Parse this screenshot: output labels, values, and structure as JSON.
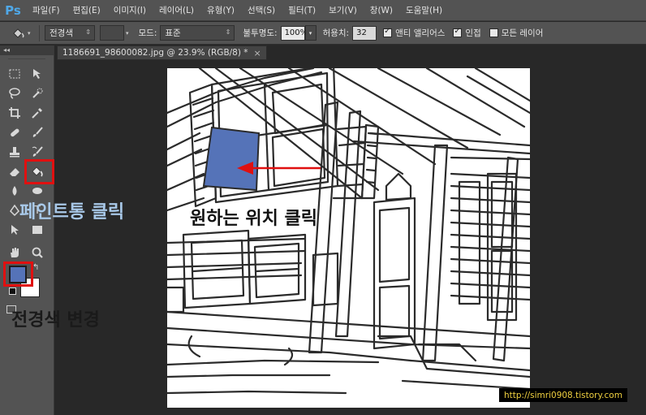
{
  "app": {
    "logo": "Ps"
  },
  "menu": [
    "파일(F)",
    "편집(E)",
    "이미지(I)",
    "레이어(L)",
    "유형(Y)",
    "선택(S)",
    "필터(T)",
    "보기(V)",
    "창(W)",
    "도움말(H)"
  ],
  "options": {
    "fill_source": "전경색",
    "mode_label": "모드:",
    "mode_value": "표준",
    "opacity_label": "불투명도:",
    "opacity_value": "100%",
    "tolerance_label": "허용치:",
    "tolerance_value": "32",
    "antialias_label": "앤티 앨리어스",
    "antialias_checked": true,
    "contiguous_label": "인접",
    "contiguous_checked": true,
    "all_layers_label": "모든 레이어",
    "all_layers_checked": false
  },
  "document": {
    "tab_title": "1186691_98600082.jpg @ 23.9% (RGB/8) *"
  },
  "colors": {
    "foreground": "#5573b8",
    "background": "#ffffff",
    "highlight": "#e01010",
    "annotation_blue": "#a8c8e8"
  },
  "annotations": {
    "paint_bucket": "페인트통 클릭",
    "click_location": "원하는 위치 클릭",
    "change_fg": "전경색 변경"
  },
  "watermark": "http://simri0908.tistory.com"
}
